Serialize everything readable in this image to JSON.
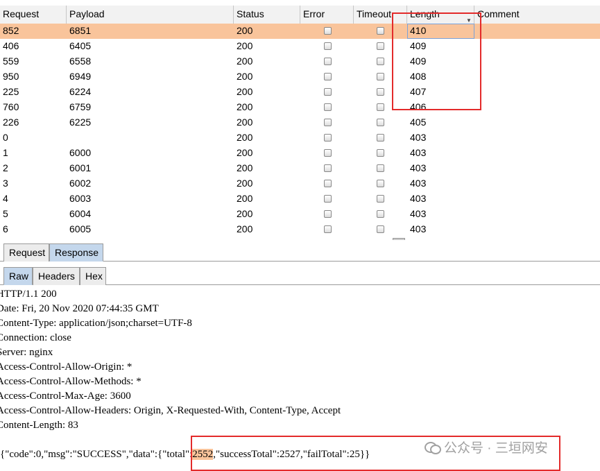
{
  "table": {
    "columns": [
      "Request",
      "Payload",
      "Status",
      "Error",
      "Timeout",
      "Length",
      "Comment"
    ],
    "rows": [
      [
        "852",
        "6851",
        "200",
        "410"
      ],
      [
        "406",
        "6405",
        "200",
        "409"
      ],
      [
        "559",
        "6558",
        "200",
        "409"
      ],
      [
        "950",
        "6949",
        "200",
        "408"
      ],
      [
        "225",
        "6224",
        "200",
        "407"
      ],
      [
        "760",
        "6759",
        "200",
        "406"
      ],
      [
        "226",
        "6225",
        "200",
        "405"
      ],
      [
        "0",
        "",
        "200",
        "403"
      ],
      [
        "1",
        "6000",
        "200",
        "403"
      ],
      [
        "2",
        "6001",
        "200",
        "403"
      ],
      [
        "3",
        "6002",
        "200",
        "403"
      ],
      [
        "4",
        "6003",
        "200",
        "403"
      ],
      [
        "5",
        "6004",
        "200",
        "403"
      ],
      [
        "6",
        "6005",
        "200",
        "403"
      ]
    ]
  },
  "tabs": {
    "top": [
      "Request",
      "Response"
    ],
    "sub": [
      "Raw",
      "Headers",
      "Hex"
    ]
  },
  "raw": {
    "lines": [
      "HTTP/1.1 200",
      "Date: Fri, 20 Nov 2020 07:44:35 GMT",
      "Content-Type: application/json;charset=UTF-8",
      "Connection: close",
      "Server: nginx",
      "Access-Control-Allow-Origin: *",
      "Access-Control-Allow-Methods: *",
      "Access-Control-Max-Age: 3600",
      "Access-Control-Allow-Headers: Origin, X-Requested-With, Content-Type, Accept",
      "Content-Length: 83"
    ],
    "body_before": "{\"code\":0,\"msg\":\"SUCCESS\",\"data\":{\"total\":",
    "body_highlight": "2552",
    "body_after": ",\"successTotal\":2527,\"failTotal\":25}}"
  },
  "watermark": "公众号 · 三垣网安",
  "colors": {
    "selected_row": "#f9c49b",
    "active_tab": "#c4d7ec",
    "annotation": "#e32a2a"
  }
}
